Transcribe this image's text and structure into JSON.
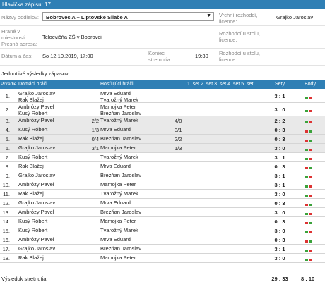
{
  "header": {
    "title": "Hlavička zápisu: 17"
  },
  "form": {
    "team_label": "Názvy oddielov:",
    "team_value": "Bobrovec A – Liptovské Sliače A",
    "chief_ref_label": "Vrchní rozhodcí, licence:",
    "chief_ref_value": "Grajko Jaroslav",
    "venue_label": "Hrané v miestnosti Presná adresa:",
    "venue_value": "Telocvičňa ZŠ v Bobrovci",
    "table_ref_label": "Rozhodcí u stolu, licence:",
    "datetime_label": "Dátum a čas:",
    "datetime_value": "So 12.10.2019, 17:00",
    "end_label": "Koniec stretnutia:",
    "end_value": "19:30",
    "table_ref2_label": "Rozhodcí u stolu, licence:"
  },
  "results": {
    "section_title": "Jednotlivé výsledky zápasov",
    "columns": {
      "order": "Poradie",
      "home": "Domáci hráči",
      "guest": "Hosťujúci hráči",
      "sets": "1. set 2. set 3. set 4. set 5. set",
      "sety": "Sety",
      "body": "Body"
    },
    "rows": [
      {
        "n": "1.",
        "home": [
          "Grajko Jaroslav",
          "Rak Blažej"
        ],
        "guest": [
          "Mrva Eduard",
          "Tvarožný Marek"
        ],
        "ss": "",
        "s1": "",
        "sety": "3 : 1",
        "pts": [
          "g",
          "r"
        ],
        "grey": false,
        "double": true
      },
      {
        "n": "2.",
        "home": [
          "Ambrózy Pavel",
          "Kusý Róbert"
        ],
        "guest": [
          "Mamojka Peter",
          "Brezňan Jaroslav"
        ],
        "ss": "",
        "s1": "",
        "sety": "3 : 0",
        "pts": [
          "g",
          "r"
        ],
        "grey": false,
        "double": true
      },
      {
        "n": "3.",
        "home": [
          "Ambrózy Pavel"
        ],
        "guest": [
          "Tvarožný Marek"
        ],
        "ss": "2/2",
        "s1": "4/0",
        "sety": "2 : 2",
        "pts": [
          "g",
          "r"
        ],
        "grey": true,
        "double": false
      },
      {
        "n": "4.",
        "home": [
          "Kusý Róbert"
        ],
        "guest": [
          "Mrva Eduard"
        ],
        "ss": "1/3",
        "s1": "3/1",
        "sety": "0 : 3",
        "pts": [
          "r",
          "g"
        ],
        "grey": true,
        "double": false
      },
      {
        "n": "5.",
        "home": [
          "Rak Blažej"
        ],
        "guest": [
          "Brezňan Jaroslav"
        ],
        "ss": "0/4",
        "s1": "2/2",
        "sety": "0 : 3",
        "pts": [
          "r",
          "g"
        ],
        "grey": true,
        "double": false
      },
      {
        "n": "6.",
        "home": [
          "Grajko Jaroslav"
        ],
        "guest": [
          "Mamojka Peter"
        ],
        "ss": "3/1",
        "s1": "1/3",
        "sety": "3 : 0",
        "pts": [
          "g",
          "r"
        ],
        "grey": true,
        "double": false
      },
      {
        "n": "7.",
        "home": [
          "Kusý Róbert"
        ],
        "guest": [
          "Tvarožný Marek"
        ],
        "ss": "",
        "s1": "",
        "sety": "3 : 1",
        "pts": [
          "g",
          "r"
        ],
        "grey": false,
        "double": false
      },
      {
        "n": "8.",
        "home": [
          "Rak Blažej"
        ],
        "guest": [
          "Mrva Eduard"
        ],
        "ss": "",
        "s1": "",
        "sety": "0 : 3",
        "pts": [
          "r",
          "g"
        ],
        "grey": false,
        "double": false
      },
      {
        "n": "9.",
        "home": [
          "Grajko Jaroslav"
        ],
        "guest": [
          "Brezňan Jaroslav"
        ],
        "ss": "",
        "s1": "",
        "sety": "3 : 1",
        "pts": [
          "g",
          "r"
        ],
        "grey": false,
        "double": false
      },
      {
        "n": "10.",
        "home": [
          "Ambrózy Pavel"
        ],
        "guest": [
          "Mamojka Peter"
        ],
        "ss": "",
        "s1": "",
        "sety": "3 : 1",
        "pts": [
          "g",
          "r"
        ],
        "grey": false,
        "double": false
      },
      {
        "n": "11.",
        "home": [
          "Rak Blažej"
        ],
        "guest": [
          "Tvarožný Marek"
        ],
        "ss": "",
        "s1": "",
        "sety": "3 : 0",
        "pts": [
          "g",
          "r"
        ],
        "grey": false,
        "double": false
      },
      {
        "n": "12.",
        "home": [
          "Grajko Jaroslav"
        ],
        "guest": [
          "Mrva Eduard"
        ],
        "ss": "",
        "s1": "",
        "sety": "0 : 3",
        "pts": [
          "r",
          "g"
        ],
        "grey": false,
        "double": false
      },
      {
        "n": "13.",
        "home": [
          "Ambrózy Pavel"
        ],
        "guest": [
          "Brezňan Jaroslav"
        ],
        "ss": "",
        "s1": "",
        "sety": "3 : 0",
        "pts": [
          "g",
          "r"
        ],
        "grey": false,
        "double": false
      },
      {
        "n": "14.",
        "home": [
          "Kusý Róbert"
        ],
        "guest": [
          "Mamojka Peter"
        ],
        "ss": "",
        "s1": "",
        "sety": "0 : 3",
        "pts": [
          "r",
          "g"
        ],
        "grey": false,
        "double": false
      },
      {
        "n": "15.",
        "home": [
          "Kusý Róbert"
        ],
        "guest": [
          "Tvarožný Marek"
        ],
        "ss": "",
        "s1": "",
        "sety": "3 : 0",
        "pts": [
          "g",
          "r"
        ],
        "grey": false,
        "double": false
      },
      {
        "n": "16.",
        "home": [
          "Ambrózy Pavel"
        ],
        "guest": [
          "Mrva Eduard"
        ],
        "ss": "",
        "s1": "",
        "sety": "0 : 3",
        "pts": [
          "r",
          "g"
        ],
        "grey": false,
        "double": false
      },
      {
        "n": "17.",
        "home": [
          "Grajko Jaroslav"
        ],
        "guest": [
          "Brezňan Jaroslav"
        ],
        "ss": "",
        "s1": "",
        "sety": "3 : 1",
        "pts": [
          "g",
          "r"
        ],
        "grey": false,
        "double": false
      },
      {
        "n": "18.",
        "home": [
          "Rak Blažej"
        ],
        "guest": [
          "Mamojka Peter"
        ],
        "ss": "",
        "s1": "",
        "sety": "3 : 0",
        "pts": [
          "g",
          "r"
        ],
        "grey": false,
        "double": false
      }
    ],
    "footer": {
      "label": "Výsledok stretnutia:",
      "sety": "29 : 33",
      "body": "8 : 10"
    }
  }
}
